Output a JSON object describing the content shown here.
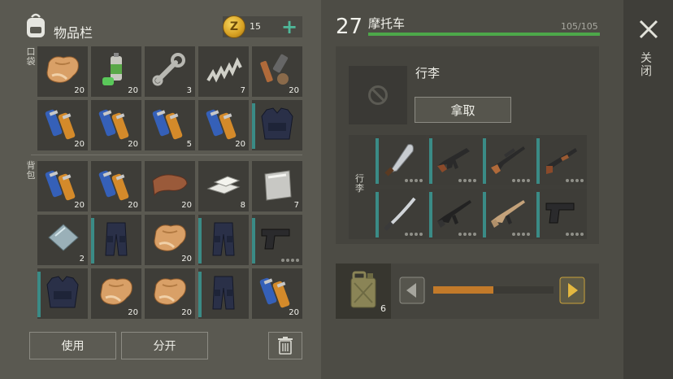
{
  "inventory": {
    "title": "物品栏",
    "coins": "15",
    "coin_symbol": "Z",
    "add_symbol": "+",
    "pocket_label": "口袋",
    "backpack_label": "背包"
  },
  "slots": [
    {
      "item": "cloth-icon",
      "count": "20"
    },
    {
      "item": "spray-can-icon",
      "count": "20"
    },
    {
      "item": "wrench-icon",
      "count": "3"
    },
    {
      "item": "spring-icon",
      "count": "7"
    },
    {
      "item": "parts-icon",
      "count": "20"
    },
    {
      "item": "battery-icon",
      "count": "20"
    },
    {
      "item": "battery-icon",
      "count": "20"
    },
    {
      "item": "battery-icon",
      "count": "5"
    },
    {
      "item": "battery-icon",
      "count": "20"
    },
    {
      "item": "vest-icon",
      "count": ""
    },
    {
      "item": "battery-icon",
      "count": "20"
    },
    {
      "item": "battery-icon",
      "count": "20"
    },
    {
      "item": "leather-icon",
      "count": "20"
    },
    {
      "item": "metal-bars-icon",
      "count": "8"
    },
    {
      "item": "steel-plate-icon",
      "count": "7"
    },
    {
      "item": "glass-plate-icon",
      "count": "2"
    },
    {
      "item": "pants-icon",
      "count": ""
    },
    {
      "item": "cloth-icon",
      "count": "20"
    },
    {
      "item": "pants-icon",
      "count": ""
    },
    {
      "item": "pistol-icon",
      "count": ""
    },
    {
      "item": "vest-icon",
      "count": ""
    },
    {
      "item": "cloth-icon",
      "count": "20"
    },
    {
      "item": "cloth-icon",
      "count": "20"
    },
    {
      "item": "pants-icon",
      "count": ""
    },
    {
      "item": "battery-icon",
      "count": "20"
    }
  ],
  "buttons": {
    "use": "使用",
    "split": "分开"
  },
  "vehicle": {
    "level": "27",
    "name": "摩托车",
    "hp": "105/105",
    "hp_fraction": 1.0,
    "cargo_label": "行李",
    "take": "拿取",
    "trunk_label": "行李"
  },
  "trunk": [
    {
      "item": "machete-icon"
    },
    {
      "item": "assault-rifle-icon"
    },
    {
      "item": "sniper-rifle-icon"
    },
    {
      "item": "shotgun-icon"
    },
    {
      "item": "katana-icon"
    },
    {
      "item": "m4-rifle-icon"
    },
    {
      "item": "scar-rifle-icon"
    },
    {
      "item": "pistol-icon"
    }
  ],
  "transfer": {
    "fuel_count": "6",
    "slider_fraction": 0.5
  },
  "close": {
    "label": "关闭"
  },
  "colors": {
    "hp_bar": "#4da84a",
    "slider": "#c27a2a",
    "accent_teal": "#3a8b86",
    "coin_plus": "#4fb89a"
  }
}
